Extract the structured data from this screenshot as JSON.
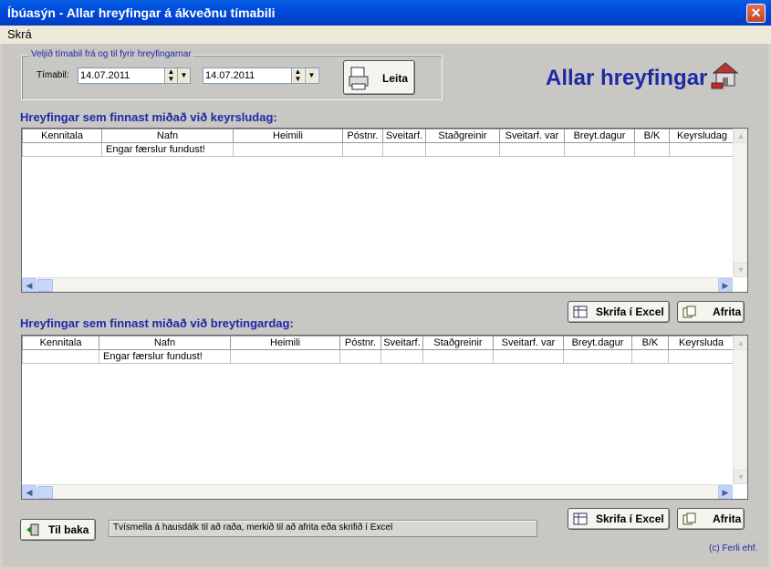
{
  "window": {
    "title": "Íbúasýn - Allar hreyfingar á ákveðnu tímabili",
    "close_glyph": "✕"
  },
  "menu": {
    "items": [
      "Skrá"
    ]
  },
  "filter": {
    "legend": "Veljið tímabil frá og til fyrir hreyfingarnar",
    "label": "Tímabil:",
    "from_date": "14.07.2011",
    "to_date": "14.07.2011",
    "search_button": "Leita"
  },
  "header_title": "Allar hreyfingar",
  "grid1": {
    "title": "Hreyfingar sem finnast miðað við keyrsludag:",
    "columns": [
      "Kennitala",
      "Nafn",
      "Heimili",
      "Póstnr.",
      "Sveitarf.",
      "Staðgreinir",
      "Sveitarf. var",
      "Breyt.dagur",
      "B/K",
      "Keyrsludag"
    ],
    "empty_message": "Engar færslur fundust!"
  },
  "grid2": {
    "title": "Hreyfingar sem finnast miðað við breytingardag:",
    "columns": [
      "Kennitala",
      "Nafn",
      "Heimili",
      "Póstnr.",
      "Sveitarf.",
      "Staðgreinir",
      "Sveitarf. var",
      "Breyt.dagur",
      "B/K",
      "Keyrsluda"
    ],
    "empty_message": "Engar færslur fundust!"
  },
  "buttons": {
    "excel": "Skrifa í Excel",
    "copy": "Afrita",
    "back": "Til baka"
  },
  "status_text": "Tvísmella á hausdálk til að raða, merkið til að afrita eða skrifið í Excel",
  "copyright": "(c) Ferli ehf."
}
